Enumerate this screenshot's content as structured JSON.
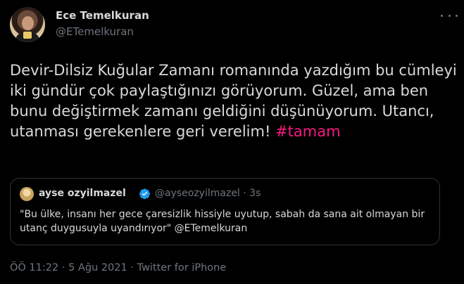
{
  "author": {
    "name": "Ece Temelkuran",
    "handle": "@ETemelkuran"
  },
  "tweet": {
    "text": "Devir-Dilsiz Kuğular Zamanı romanında yazdığım bu cümleyi iki gündür çok paylaştığınızı görüyorum. Güzel, ama ben bunu değiştirmek zamanı geldiğini düşünüyorum. Utancı, utanması gerekenlere geri verelim!",
    "hashtag": "#tamam"
  },
  "quote": {
    "name": "ayse ozyilmazel",
    "handle_time": "@ayseozyilmazel · 3s",
    "text": "\"Bu ülke, insanı her gece çaresizlik hissiyle uyutup, sabah da sana ait olmayan bir utanç duygusuyla uyandırıyor\" @ETemelkuran"
  },
  "meta": {
    "time": "ÖÖ 11:22",
    "separator1": " · ",
    "date": "5 Ağu 2021",
    "separator2": " · ",
    "source": "Twitter for iPhone"
  },
  "colors": {
    "background": "#000000",
    "text": "#d9d9d9",
    "muted": "#6e767d",
    "hashtag": "#f91880",
    "verified": "#1d9bf0",
    "border": "#2f3336"
  },
  "icons": {
    "more": "more-horizontal-icon",
    "verified": "verified-badge-icon"
  }
}
